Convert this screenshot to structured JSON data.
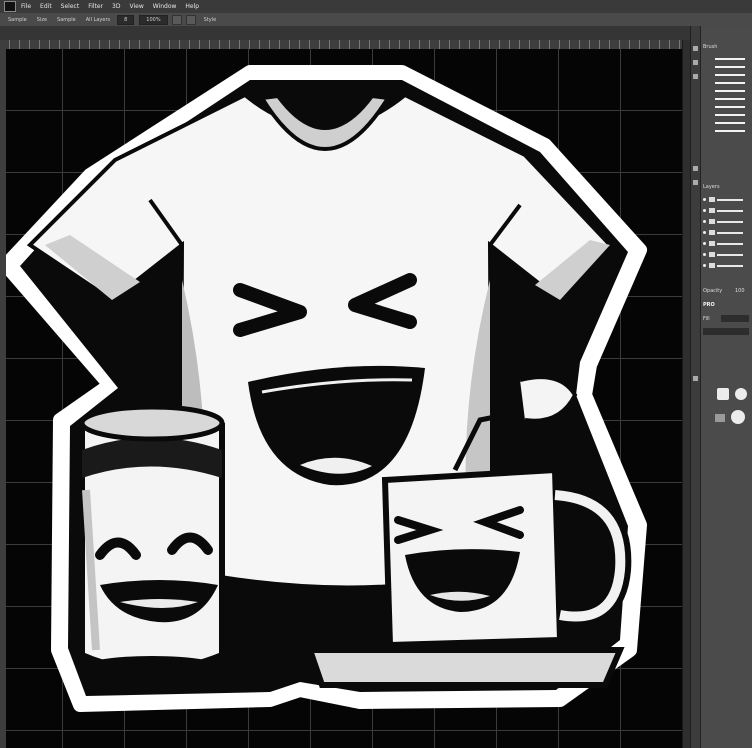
{
  "menubar": {
    "items": [
      "File",
      "Edit",
      "Select",
      "Filter",
      "3D",
      "View",
      "Window",
      "Help"
    ]
  },
  "optionsbar": {
    "labels": [
      "Sample",
      "Size",
      "Sample",
      "All Layers"
    ],
    "field_values": [
      "8",
      "100%"
    ],
    "tail_label": "Style"
  },
  "panels": {
    "top_header": "Brush",
    "layers_header": "Layers",
    "opacity_label": "Opacity",
    "opacity_value": "100",
    "pro_label": "PRO",
    "fill_label": "Fill"
  },
  "canvas": {
    "artwork": "sticker illustration of laughing t-shirt, can and mug"
  },
  "colors": {
    "canvas_bg": "#050505",
    "grid": "#3b3b3b",
    "panel_bg": "#4b4b4b",
    "menubar_bg": "#3a3a3a",
    "sticker_white": "#ffffff",
    "ink": "#0a0a0a"
  }
}
